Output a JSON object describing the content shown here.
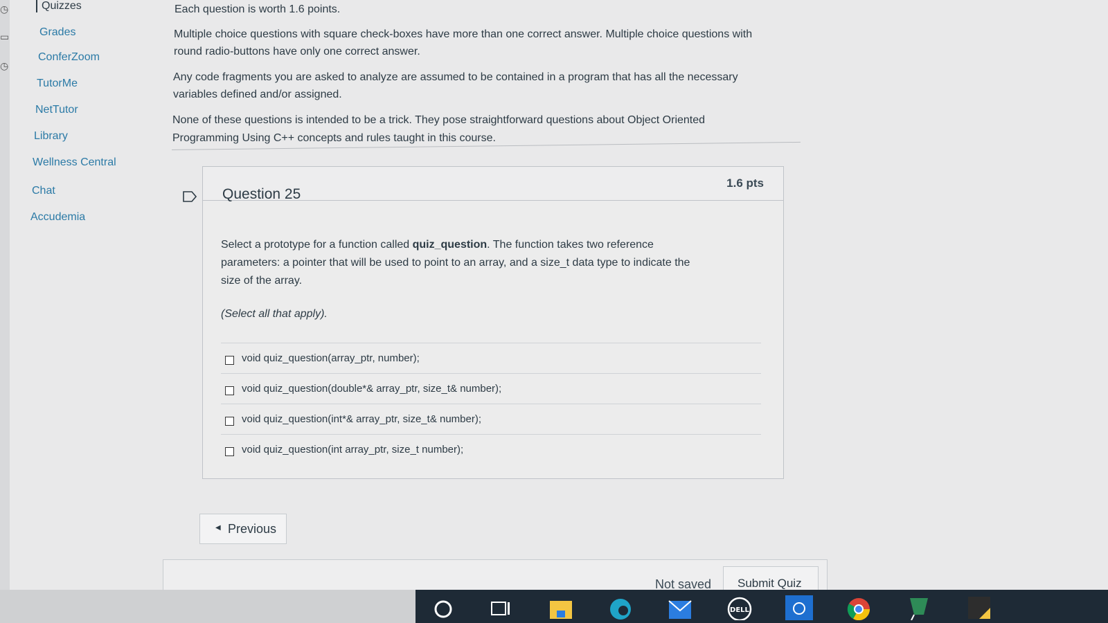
{
  "nav": {
    "items": [
      {
        "label": "Quizzes",
        "active": true
      },
      {
        "label": "Grades"
      },
      {
        "label": "ConferZoom"
      },
      {
        "label": "TutorMe"
      },
      {
        "label": "NetTutor"
      },
      {
        "label": "Library"
      },
      {
        "label": "Wellness Central"
      },
      {
        "label": "Chat"
      },
      {
        "label": "Accudemia"
      }
    ]
  },
  "intro": {
    "p1": "Each question is worth 1.6 points.",
    "p2a": "Multiple choice questions with square check-boxes have more than one correct answer.  Multiple choice questions with",
    "p2b": "round radio-buttons have only one correct answer.",
    "p3a": "Any code fragments you are asked to analyze are assumed to be contained in a program that has all the necessary",
    "p3b": "variables defined and/or assigned.",
    "p4a": "None of these questions is intended to be a trick.  They pose straightforward questions about Object Oriented",
    "p4b": "Programming Using C++  concepts and rules taught in this course."
  },
  "question": {
    "title": "Question 25",
    "points": "1.6 pts",
    "body_prefix": "Select a prototype for a function called ",
    "body_bold": "quiz_question",
    "body_suffix": ".  The function takes two reference",
    "body_line2": "parameters:  a pointer that will be used to point to an array, and a size_t data type to indicate the",
    "body_line3": "size of the array.",
    "hint": "(Select all that apply).",
    "answers": [
      {
        "label": "void quiz_question(array_ptr, number);",
        "checked": false
      },
      {
        "label": "void quiz_question(double*& array_ptr, size_t& number);",
        "checked": false
      },
      {
        "label": "void quiz_question(int*& array_ptr, size_t& number);",
        "checked": false
      },
      {
        "label": "void quiz_question(int array_ptr, size_t number);",
        "checked": false
      }
    ]
  },
  "navigation": {
    "previous_label": "Previous"
  },
  "footer": {
    "save_status": "Not saved",
    "submit_label": "Submit Quiz"
  },
  "taskbar": {
    "icons": [
      "search-icon",
      "task-view-icon",
      "file-explorer-icon",
      "edge-icon",
      "mail-icon",
      "dell-icon",
      "cortana-icon",
      "chrome-icon",
      "snipping-tool-icon",
      "sticky-notes-icon"
    ]
  },
  "colors": {
    "link": "#2b7aa6",
    "text": "#2d3b45",
    "taskbar": "#1e2a36"
  }
}
